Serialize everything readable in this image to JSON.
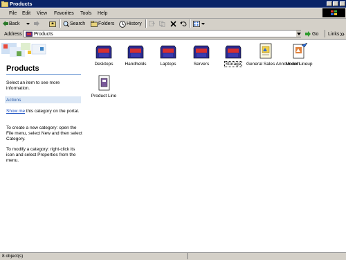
{
  "window": {
    "title": "Products"
  },
  "menu": [
    "File",
    "Edit",
    "View",
    "Favorites",
    "Tools",
    "Help"
  ],
  "toolbar": {
    "back": "Back",
    "search": "Search",
    "folders": "Folders",
    "history": "History"
  },
  "address": {
    "label": "Address",
    "value": "Products",
    "go": "Go",
    "links": "Links"
  },
  "left_panel": {
    "title": "Products",
    "prompt": "Select an item to see more information.",
    "actions_header": "Actions",
    "show_me_link": "Show me",
    "show_me_rest": " this category on the portal.",
    "create_help": "To create a new category: open the File menu, select New and then select Category.",
    "modify_help": "To modify a category: right-click its icon and select Properties from the menu."
  },
  "items": [
    {
      "label": "Desktops",
      "icon": "category-folder-icon"
    },
    {
      "label": "Handhelds",
      "icon": "category-folder-icon"
    },
    {
      "label": "Laptops",
      "icon": "category-folder-icon"
    },
    {
      "label": "Servers",
      "icon": "category-folder-icon"
    },
    {
      "label": "Storage",
      "icon": "category-folder-icon"
    },
    {
      "label": "General Sales Announcem...",
      "icon": "document-icon"
    },
    {
      "label": "Model Lineup",
      "icon": "document-icon"
    },
    {
      "label": "Product Line",
      "icon": "document-icon"
    }
  ],
  "status": {
    "text": "8 object(s)"
  }
}
